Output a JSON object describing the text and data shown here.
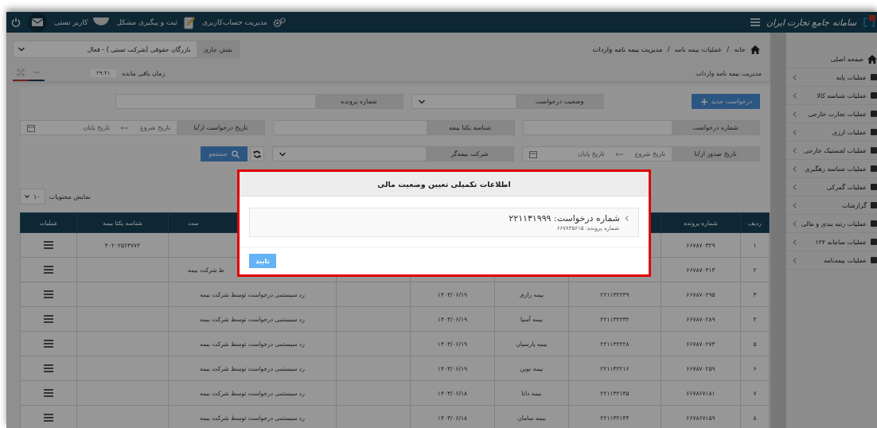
{
  "topbar": {
    "logo_text": "سامانه جامع تجارت ایران",
    "links": [
      {
        "kind": "settings",
        "label": "مدیریت حساب‌کاربری"
      },
      {
        "kind": "notes",
        "label": "ثبت و پیگیری مشکل"
      },
      {
        "kind": "user",
        "label": "کاربر تستی"
      }
    ]
  },
  "sidebar": {
    "items": [
      {
        "label": "صفحه اصلی",
        "has_submenu": false
      },
      {
        "label": "عملیات پایه",
        "has_submenu": true
      },
      {
        "label": "عملیات شناسه کالا",
        "has_submenu": true
      },
      {
        "label": "عملیات تجارت خارجی",
        "has_submenu": true
      },
      {
        "label": "عملیات ارزی",
        "has_submenu": true
      },
      {
        "label": "عملیات لجستیک خارجی",
        "has_submenu": true
      },
      {
        "label": "عملیات شناسه رهگیری",
        "has_submenu": true
      },
      {
        "label": "عملیات گمرکی",
        "has_submenu": true
      },
      {
        "label": "گزارشات",
        "has_submenu": true
      },
      {
        "label": "عملیات رتبه بندی و مالی",
        "has_submenu": true
      },
      {
        "label": "عملیات سامانه ۱۲۴",
        "has_submenu": true
      },
      {
        "label": "عملیات بیمه‌نامه",
        "has_submenu": true
      }
    ]
  },
  "breadcrumb": {
    "separator": "/",
    "items": [
      "خانه",
      "عملیات بیمه نامه",
      "مدیریت بیمه نامه واردات"
    ]
  },
  "role": {
    "label": "نقش جاری",
    "value": "بازرگان حقوقی (شرکت تستی ) - فعال"
  },
  "page_title": "مدیریت بیمه نامه واردات",
  "session": {
    "label": "زمان باقی مانده",
    "time": "۲۹:۴۱"
  },
  "new_button": "درخواست جدید",
  "filters": [
    [
      {
        "kind": "select",
        "label": "وضعیت درخواست"
      },
      {
        "kind": "input",
        "label": "شماره پرونده"
      }
    ],
    [
      {
        "kind": "input",
        "label": "شماره درخواست"
      },
      {
        "kind": "input",
        "label": "شناسه یکتا بیمه"
      },
      {
        "kind": "daterange",
        "label": "تاریخ درخواست از/تا",
        "start": "تاریخ شروع",
        "end": "تاریخ پایان"
      }
    ],
    [
      {
        "kind": "daterange",
        "label": "تاریخ صدور از/تا",
        "start": "تاریخ شروع",
        "end": "تاریخ پایان"
      },
      {
        "kind": "select",
        "label": "شرکت بیمه‌گر"
      },
      {
        "kind": "actions",
        "search": "جستجو"
      }
    ]
  ],
  "page_length": {
    "label": "نمایش محتویات",
    "value": "۱۰"
  },
  "table": {
    "columns": [
      "ردیف",
      "شماره پرونده",
      null,
      null,
      null,
      null,
      "ست",
      "شناسه یکتا بیمه",
      "عملیات"
    ],
    "rows": [
      [
        "۱",
        "۶۶۷۸۷۰۳۲۹",
        null,
        null,
        null,
        null,
        null,
        "۴۰۲۰۲۵۶۳۷۷۲"
      ],
      [
        "۲",
        "۶۶۷۸۷۰۳۱۳",
        null,
        null,
        null,
        null,
        "ط شرکت بیمه",
        null
      ],
      [
        "۳",
        "۶۶۷۸۷۰۲۹۵",
        "۲۲۱۱۳۲۲۳۹",
        "بیمه رازی",
        "۱۴۰۳/۰۶/۱۹",
        null,
        "رد سیستمی درخواست توسط شرکت بیمه",
        null
      ],
      [
        "۴",
        "۶۶۷۸۷۰۲۸۹",
        "۲۲۱۱۳۲۲۳۲",
        "بیمه آسیا",
        "۱۴۰۳/۰۶/۱۹",
        null,
        "رد سیستمی درخواست توسط شرکت بیمه",
        null
      ],
      [
        "۵",
        "۶۶۷۸۷۰۲۷۳",
        "۲۲۱۱۳۲۲۲۸",
        "بیمه پارسیان",
        "۱۴۰۳/۰۶/۱۹",
        null,
        "رد سیستمی درخواست توسط شرکت بیمه",
        null
      ],
      [
        "۶",
        "۶۶۷۸۷۰۲۵۹",
        "۲۲۱۱۳۲۲۱۶",
        "بیمه نوین",
        "۱۴۰۳/۰۶/۱۹",
        null,
        "رد سیستمی درخواست توسط شرکت بیمه",
        null
      ],
      [
        "۷",
        "۶۶۷۸۶۷۱۸۱",
        "۲۲۱۱۳۲۱۴۵",
        "بیمه دانا",
        "۱۴۰۳/۰۶/۱۸",
        null,
        "رد سیستمی درخواست توسط شرکت بیمه",
        null
      ],
      [
        "۸",
        "۶۶۷۸۶۷۱۵۹",
        "۲۲۱۱۳۲۱۴۴",
        "بیمه سامان",
        "۱۴۰۳/۰۶/۱۸",
        null,
        "رد سیستمی درخواست توسط شرکت بیمه",
        null
      ]
    ]
  },
  "modal": {
    "title": "اطلاعات تکمیلی تعیین وضعیت مالی",
    "record": "شماره درخواست: ۲۲۱۱۳۱۹۹۹",
    "sub": "شماره پرونده: ۶۶۷۸۴۵۶۱۵",
    "confirm": "تایید"
  }
}
